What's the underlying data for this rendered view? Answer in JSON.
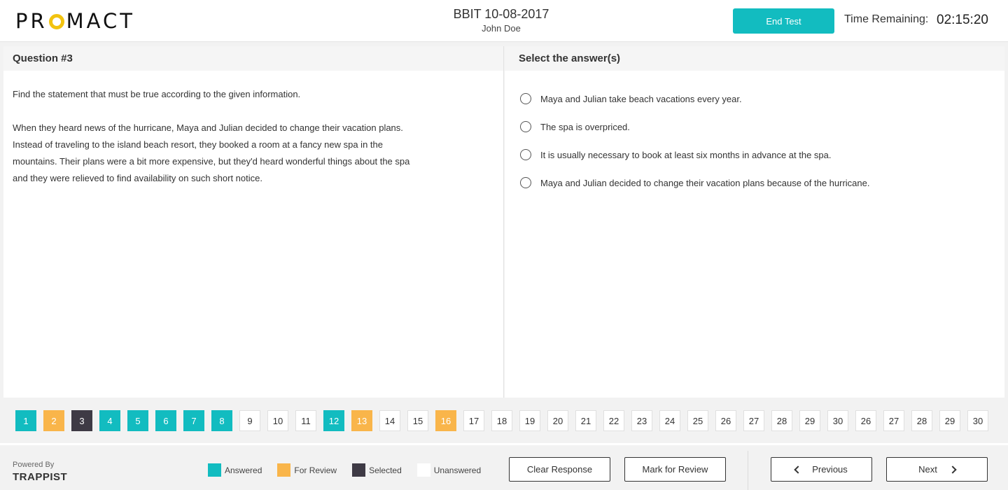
{
  "header": {
    "logo_left": "PR",
    "logo_right": "MACT",
    "test_title": "BBIT 10-08-2017",
    "candidate_name": "John Doe",
    "end_test_label": "End Test",
    "time_label": "Time Remaining:",
    "time_value": "02:15:20"
  },
  "question": {
    "heading": "Question #3",
    "prompt": "Find the statement that must be true according to the given information.",
    "passage": "When they heard news of the hurricane, Maya and Julian decided to change their vacation plans. Instead of traveling to the island beach resort, they booked a room at a fancy new spa in the mountains. Their plans were a bit more expensive, but they'd heard wonderful things about the spa and they were relieved to find availability on such short notice."
  },
  "answers": {
    "heading": "Select the answer(s)",
    "options": [
      "Maya and Julian take beach vacations every year.",
      "The spa is overpriced.",
      "It is usually necessary to book at least six months in advance at the spa.",
      "Maya and Julian decided to change their vacation plans because of the hurricane."
    ]
  },
  "palette": [
    {
      "num": "1",
      "status": "answered"
    },
    {
      "num": "2",
      "status": "review"
    },
    {
      "num": "3",
      "status": "selected"
    },
    {
      "num": "4",
      "status": "answered"
    },
    {
      "num": "5",
      "status": "answered"
    },
    {
      "num": "6",
      "status": "answered"
    },
    {
      "num": "7",
      "status": "answered"
    },
    {
      "num": "8",
      "status": "answered"
    },
    {
      "num": "9",
      "status": "unanswered"
    },
    {
      "num": "10",
      "status": "unanswered"
    },
    {
      "num": "11",
      "status": "unanswered"
    },
    {
      "num": "12",
      "status": "answered"
    },
    {
      "num": "13",
      "status": "review"
    },
    {
      "num": "14",
      "status": "unanswered"
    },
    {
      "num": "15",
      "status": "unanswered"
    },
    {
      "num": "16",
      "status": "review"
    },
    {
      "num": "17",
      "status": "unanswered"
    },
    {
      "num": "18",
      "status": "unanswered"
    },
    {
      "num": "19",
      "status": "unanswered"
    },
    {
      "num": "20",
      "status": "unanswered"
    },
    {
      "num": "21",
      "status": "unanswered"
    },
    {
      "num": "22",
      "status": "unanswered"
    },
    {
      "num": "23",
      "status": "unanswered"
    },
    {
      "num": "24",
      "status": "unanswered"
    },
    {
      "num": "25",
      "status": "unanswered"
    },
    {
      "num": "26",
      "status": "unanswered"
    },
    {
      "num": "27",
      "status": "unanswered"
    },
    {
      "num": "28",
      "status": "unanswered"
    },
    {
      "num": "29",
      "status": "unanswered"
    },
    {
      "num": "30",
      "status": "unanswered"
    },
    {
      "num": "26",
      "status": "unanswered"
    },
    {
      "num": "27",
      "status": "unanswered"
    },
    {
      "num": "28",
      "status": "unanswered"
    },
    {
      "num": "29",
      "status": "unanswered"
    },
    {
      "num": "30",
      "status": "unanswered"
    }
  ],
  "footer": {
    "powered_by": "Powered By",
    "brand": "TRAPPIST",
    "legend": {
      "answered": "Answered",
      "review": "For Review",
      "selected": "Selected",
      "unanswered": "Unanswered"
    },
    "clear_label": "Clear Response",
    "mark_label": "Mark for Review",
    "prev_label": "Previous",
    "next_label": "Next"
  },
  "colors": {
    "accent": "#12bcc0",
    "review": "#f9b54a",
    "selected": "#3e3a45",
    "logo_yellow": "#f2c30f"
  }
}
